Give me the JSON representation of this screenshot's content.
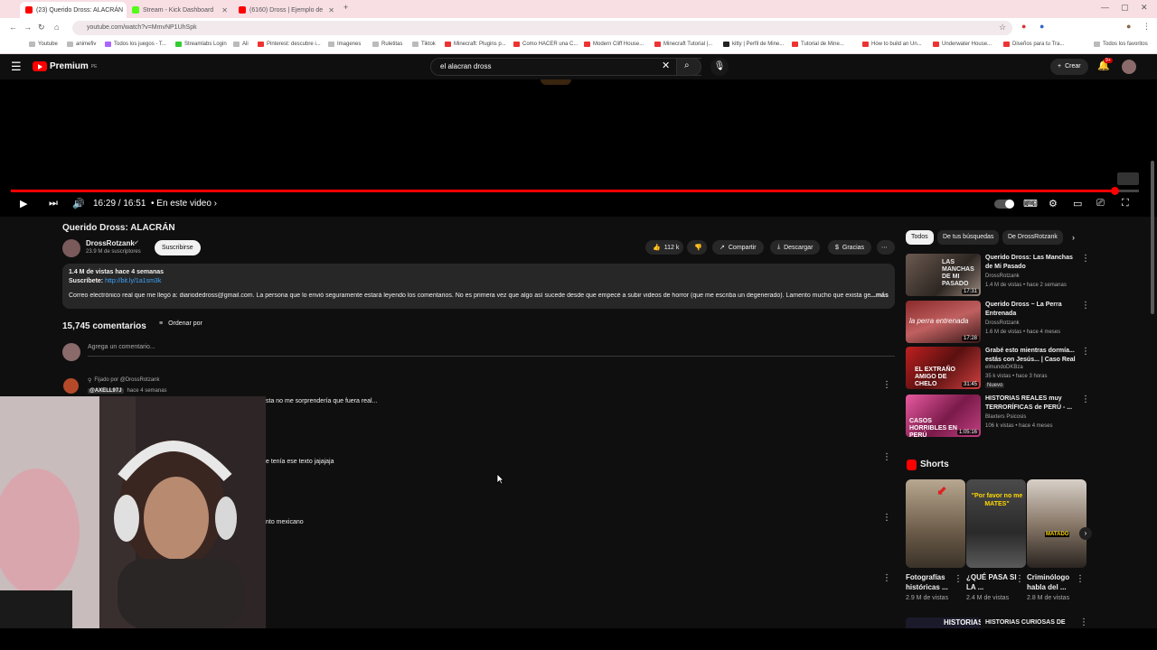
{
  "browser": {
    "tabs": [
      {
        "title": "(23) Querido Dross: ALACRÁN",
        "active": true
      },
      {
        "title": "Stream - Kick Dashboard",
        "active": false
      },
      {
        "title": "(6160) Dross | Ejemplo de",
        "active": false
      }
    ],
    "url": "youtube.com/watch?v=MmvNP1UhSpk",
    "bookmarks": [
      "Youtube",
      "animefiv",
      "Todos los juegos - T...",
      "Streamlabs Login",
      "Ali",
      "Pinterest: descubre i...",
      "Imagenes",
      "Ruletitas",
      "Tiktok",
      "Minecraft: Plugins p...",
      "Como HACER una C...",
      "Modern Cliff House...",
      "Minecraft Tutorial |...",
      "kitty | Perfil de Mine...",
      "Tutorial de Mine...",
      "How to build an Un...",
      "Underwater House...",
      "Diseños para tu Tra...",
      "Todos los favoritos"
    ]
  },
  "youtube": {
    "logo_text": "Premium",
    "logo_sup": "PE",
    "search_value": "el alacran dross",
    "create_label": "Crear",
    "notif_count": "9+"
  },
  "player": {
    "time": "16:29 / 16:51",
    "chapter": "• En este video ›",
    "progress": 0.978
  },
  "video": {
    "title": "Querido Dross: ALACRÁN",
    "channel": "DrossRotzank",
    "subscribers": "23.9 M de suscriptores",
    "subscribe_label": "Suscribirse",
    "likes": "112 k",
    "share_label": "Compartir",
    "download_label": "Descargar",
    "thanks_label": "Gracias",
    "desc_stats": "1.4 M de vistas  hace 4 semanas",
    "desc_subscribe_prefix": "Suscríbete:",
    "desc_link": "http://bit.ly/1a1sm3k",
    "desc_body": "Correo electrónico real que me llegó a: diariodedross@gmail.com. La persona que lo envió seguramente estará leyendo los comentarios. No es primera vez que algo así sucede desde que empecé a subir videos de horror (que me escriba un degenerado). Lamento mucho que exista gen",
    "desc_more": "...más"
  },
  "comments": {
    "count": "15,745 comentarios",
    "sort_label": "Ordenar por",
    "add_placeholder": "Agrega un comentario...",
    "pinned_label": "Fijado por @DrossRotzank",
    "items": [
      {
        "author": "@AXELL97J",
        "time": "hace 4 semanas",
        "text": "sta no me sorprendería que fuera real..."
      },
      {
        "text": "e tenía ese texto jajajaja"
      },
      {
        "text": "nto mexicano"
      }
    ]
  },
  "sidebar": {
    "chips": [
      "Todos",
      "De tus búsquedas",
      "De DrossRotzank"
    ],
    "recommendations": [
      {
        "title": "Querido Dross: Las Manchas de Mi Pasado",
        "channel": "DrossRotzank",
        "meta": "1.4 M de vistas • hace 2 semanas",
        "duration": "17:31",
        "thumb_text": "LAS MANCHAS DE MI PASADO"
      },
      {
        "title": "Querido Dross ~ La Perra Entrenada",
        "channel": "DrossRotzank",
        "meta": "1.6 M de vistas • hace 4 meses",
        "duration": "17:28",
        "thumb_text": "la perra entrenada"
      },
      {
        "title": "Grabé esto mientras dormía... estás con Jesús... | Caso Real",
        "channel": "elmundoDKBza",
        "meta": "35 k vistas • hace 3 horas",
        "badge": "Nuevo",
        "duration": "31:45",
        "thumb_text": "EL EXTRAÑO AMIGO DE CHELO"
      },
      {
        "title": "HISTORIAS REALES muy TERRORÍFICAS de PERÚ - ...",
        "channel": "Blaxters Psicosis",
        "meta": "106 k vistas • hace 4 meses",
        "duration": "1:05:16",
        "thumb_text": "CASOS HORRIBLES EN PERÚ"
      }
    ],
    "shorts_title": "Shorts",
    "shorts": [
      {
        "title": "Fotografías históricas ...",
        "views": "2.9 M de vistas"
      },
      {
        "title": "¿QUÉ PASA SI LA ...",
        "views": "2.4 M de vistas",
        "thumb_text": "\"Por favor no me MATES\""
      },
      {
        "title": "Criminólogo habla del ...",
        "views": "2.8 M de vistas",
        "thumb_text": "MATADO"
      }
    ],
    "next_item": {
      "title": "HISTORIAS CURIOSAS DE",
      "thumb_text": "HISTORIAS"
    }
  },
  "colors": {
    "accent": "#ff0000",
    "bg": "#0f0f0f",
    "chip": "#272727"
  }
}
